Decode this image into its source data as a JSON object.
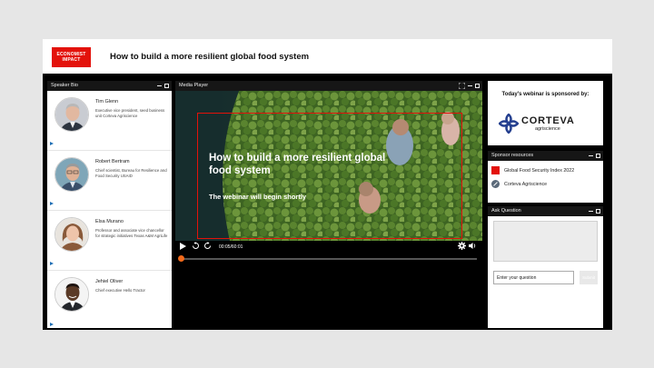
{
  "header": {
    "logo_line1": "ECONOMIST",
    "logo_line2": "IMPACT",
    "title": "How to build a more resilient global food system"
  },
  "speaker_panel": {
    "title": "Speaker Bio",
    "speakers": [
      {
        "name": "Tim Glenn",
        "title": "Executive vice president, seed business unit Corteva Agriscience"
      },
      {
        "name": "Robert Bertram",
        "title": "Chief scientist, Bureau for Resilience and Food Security USAID"
      },
      {
        "name": "Elsa Murano",
        "title": "Professor and associate vice chancellor for strategic initiatives Texas A&M AgriLife"
      },
      {
        "name": "Jehiel Oliver",
        "title": "Chief executive Hello Tractor"
      }
    ]
  },
  "media_player": {
    "title": "Media Player",
    "video_title": "How to build a more resilient global food system",
    "video_subtitle": "The webinar will begin shortly",
    "time": "00:05/60:01",
    "progress": 0.0014
  },
  "sponsor": {
    "text": "Today's webinar is sponsored by:",
    "brand_name": "CORTEVA",
    "brand_sub": "agriscience"
  },
  "resources": {
    "title": "Sponsor resources",
    "items": [
      {
        "label": "Global Food Security Index 2022",
        "icon": "red-square-icon"
      },
      {
        "label": "Corteva Agriscience",
        "icon": "link-icon"
      }
    ]
  },
  "ask": {
    "title": "Ask Question",
    "placeholder": "Enter your question",
    "submit_label": "Submit"
  },
  "colors": {
    "accent_red": "#e3120b",
    "progress_orange": "#f26a1b",
    "link_blue": "#1f6fb5",
    "corteva_blue": "#243f8f"
  }
}
